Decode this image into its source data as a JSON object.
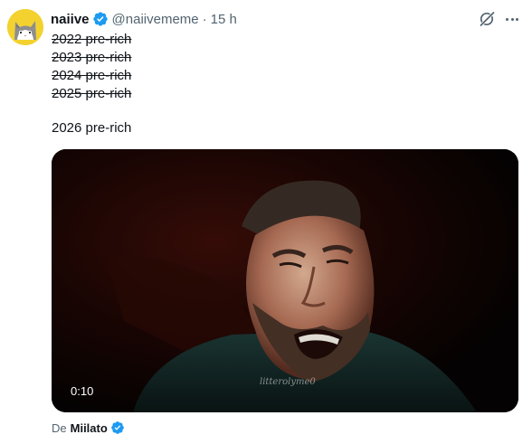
{
  "author": {
    "name": "naiive",
    "handle": "@naiivememe",
    "separator": "·",
    "time": "15 h",
    "verified": true
  },
  "post": {
    "struck_lines": [
      "2022 pre-rich ",
      "2023 pre-rich ",
      "2024 pre-rich ",
      "2025 pre-rich "
    ],
    "main_line": "2026 pre-rich"
  },
  "media": {
    "type": "video",
    "duration": "0:10",
    "watermark": "litterolyme0"
  },
  "attribution": {
    "prefix": "De",
    "source": "Miilato",
    "verified": true
  },
  "icons": {
    "avatar": "cat-avatar",
    "grok": "grok-icon",
    "more": "more-icon",
    "verified": "verified-badge-icon"
  },
  "colors": {
    "text": "#0f1419",
    "muted": "#536471",
    "verified": "#1d9bf0",
    "avatar_bg": "#f3d230"
  }
}
